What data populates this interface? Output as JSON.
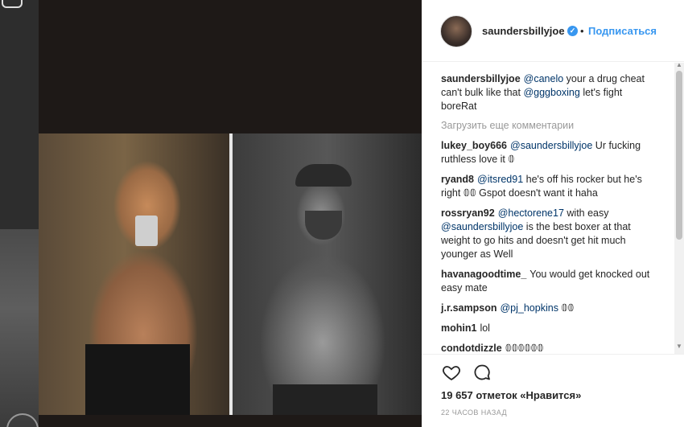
{
  "post": {
    "username": "saundersbillyjoe",
    "follow_label": "Подписаться",
    "separator": "•",
    "verified_glyph": "✓",
    "caption": {
      "user": "saundersbillyjoe",
      "mention1": "@canelo",
      "text1": " your a drug cheat can't bulk like that ",
      "mention2": "@gggboxing",
      "text2": " let's fight boreRat"
    },
    "load_more": "Загрузить еще комментарии",
    "comments": [
      {
        "user": "lukey_boy666",
        "mention": "@saundersbillyjoe",
        "text": " Ur fucking ruthless love it 𝟘"
      },
      {
        "user": "ryand8",
        "mention": "@itsred91",
        "text": " he's off his rocker but he's right 𝟘𝟘 Gspot doesn't want it haha"
      },
      {
        "user": "rossryan92",
        "mention": "@hectorene17",
        "text": " with easy ",
        "mention2": "@saundersbillyjoe",
        "text2": " is the best boxer at that weight to go hits and doesn't get hit much younger as Well"
      },
      {
        "user": "havanagoodtime_",
        "text": "You would get knocked out easy mate"
      },
      {
        "user": "j.r.sampson",
        "mention": "@pj_hopkins",
        "text": " 𝟘𝟘"
      },
      {
        "user": "mohin1",
        "text": "lol"
      },
      {
        "user": "condotdizzle",
        "text": "𝟘𝟘𝟘𝟘𝟘𝟘"
      }
    ],
    "likes": "19 657 отметок «Нравится»",
    "time": "22 часов назад"
  },
  "icons": [
    "instagram-icon",
    "verified-icon",
    "heart-icon",
    "comment-icon"
  ],
  "colors": {
    "link": "#003569",
    "accent": "#3897f0",
    "muted": "#999999",
    "text": "#262626"
  }
}
